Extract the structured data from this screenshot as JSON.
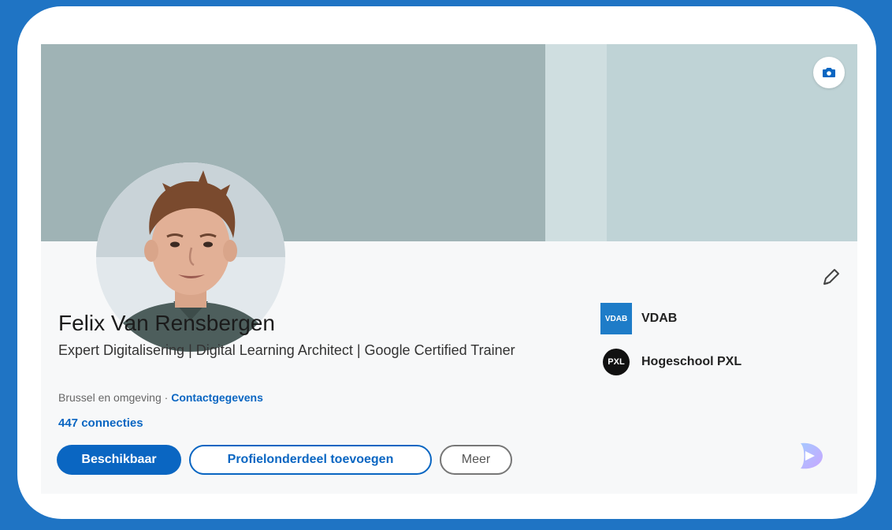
{
  "profile": {
    "name": "Felix Van Rensbergen",
    "headline": "Expert Digitalisering | Digital Learning Architect | Google Certified Trainer",
    "location": "Brussel en omgeving",
    "separator": " · ",
    "contact_link": "Contactgegevens",
    "connections": "447 connecties"
  },
  "actions": {
    "available": "Beschikbaar",
    "add_section": "Profielonderdeel toevoegen",
    "more": "Meer"
  },
  "organizations": [
    {
      "name": "VDAB",
      "logo_text": "VDAB"
    },
    {
      "name": "Hogeschool PXL",
      "logo_text": "PXL"
    }
  ],
  "icons": {
    "banner_camera": "camera-icon",
    "edit": "pencil-icon",
    "watermark": "app-logo-icon"
  },
  "colors": {
    "page_background": "#1f74c4",
    "link": "#0a66c2",
    "banner_dark": "#9fb3b5",
    "banner_light": "#bfd3d6"
  }
}
